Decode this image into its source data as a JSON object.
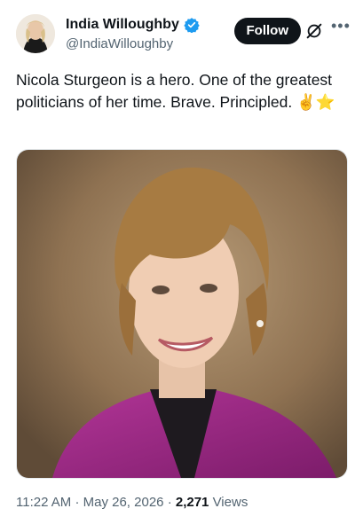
{
  "author": {
    "display_name": "India Willoughby",
    "handle": "@IndiaWilloughby",
    "verified": true
  },
  "header": {
    "follow_label": "Follow"
  },
  "tweet": {
    "text": "Nicola Sturgeon is a hero. One of the greatest politicians of her time. Brave. Principled. ✌️⭐",
    "time": "11:22 AM",
    "date": "May 26, 2026",
    "separator": "·",
    "views_count": "2,271",
    "views_label": "Views"
  },
  "icons": {
    "verified": "verified-badge-icon",
    "grok": "grok-icon",
    "more": "more-options-icon"
  },
  "colors": {
    "verified_blue": "#1d9bf0",
    "follow_bg": "#0f1419",
    "secondary_text": "#536471",
    "photo_jacket": "#a02a8a"
  }
}
